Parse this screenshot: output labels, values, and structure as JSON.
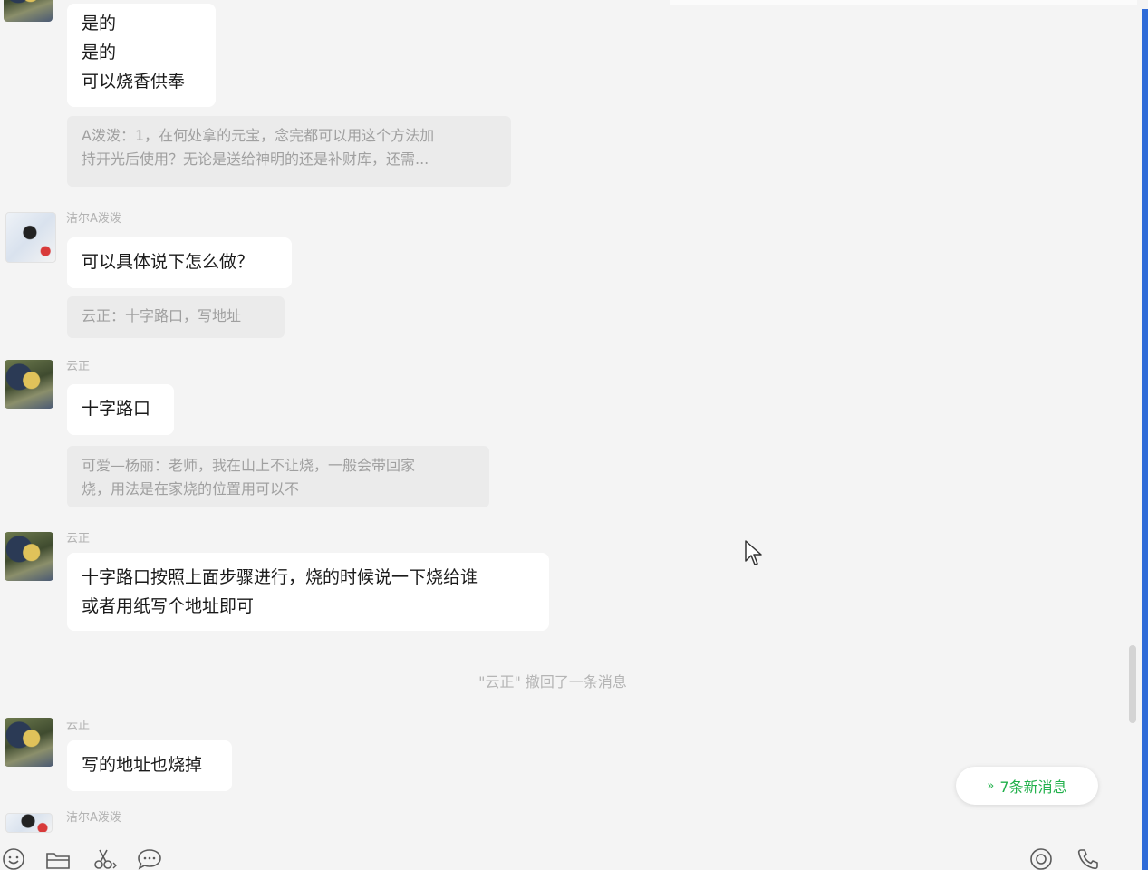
{
  "messages": [
    {
      "sender": "",
      "lines": [
        "是的",
        "是的",
        "可以烧香供奉"
      ],
      "quote": [
        "A泼泼：1，在何处拿的元宝，念完都可以用这个方法加",
        "持开光后使用？无论是送给神明的还是补财库，还需..."
      ]
    },
    {
      "sender": "洁尔A泼泼",
      "lines": [
        "可以具体说下怎么做？"
      ],
      "quote": [
        "云正：十字路口，写地址"
      ]
    },
    {
      "sender": "云正",
      "lines": [
        "十字路口"
      ],
      "quote": [
        "可爱—杨丽：老师，我在山上不让烧，一般会带回家",
        "烧，用法是在家烧的位置用可以不"
      ]
    },
    {
      "sender": "云正",
      "lines": [
        "十字路口按照上面步骤进行，烧的时候说一下烧给谁",
        "或者用纸写个地址即可"
      ]
    },
    {
      "sender": "云正",
      "lines": [
        "写的地址也烧掉"
      ]
    },
    {
      "sender": "洁尔A泼泼"
    }
  ],
  "system_note": "\"云正\" 撤回了一条消息",
  "new_messages": {
    "label": "7条新消息",
    "icon": "double-chevron-down-icon"
  },
  "toolbar": {
    "left_icons": [
      "emoji-icon",
      "folder-icon",
      "scissors-icon",
      "chat-bubble-icon"
    ],
    "right_icons": [
      "live-icon",
      "phone-icon"
    ]
  },
  "colors": {
    "background": "#f4f4f4",
    "bubble": "#ffffff",
    "quote": "#ebebeb",
    "accent_green": "#21b04b",
    "window_edge": "#2f6bd8"
  }
}
